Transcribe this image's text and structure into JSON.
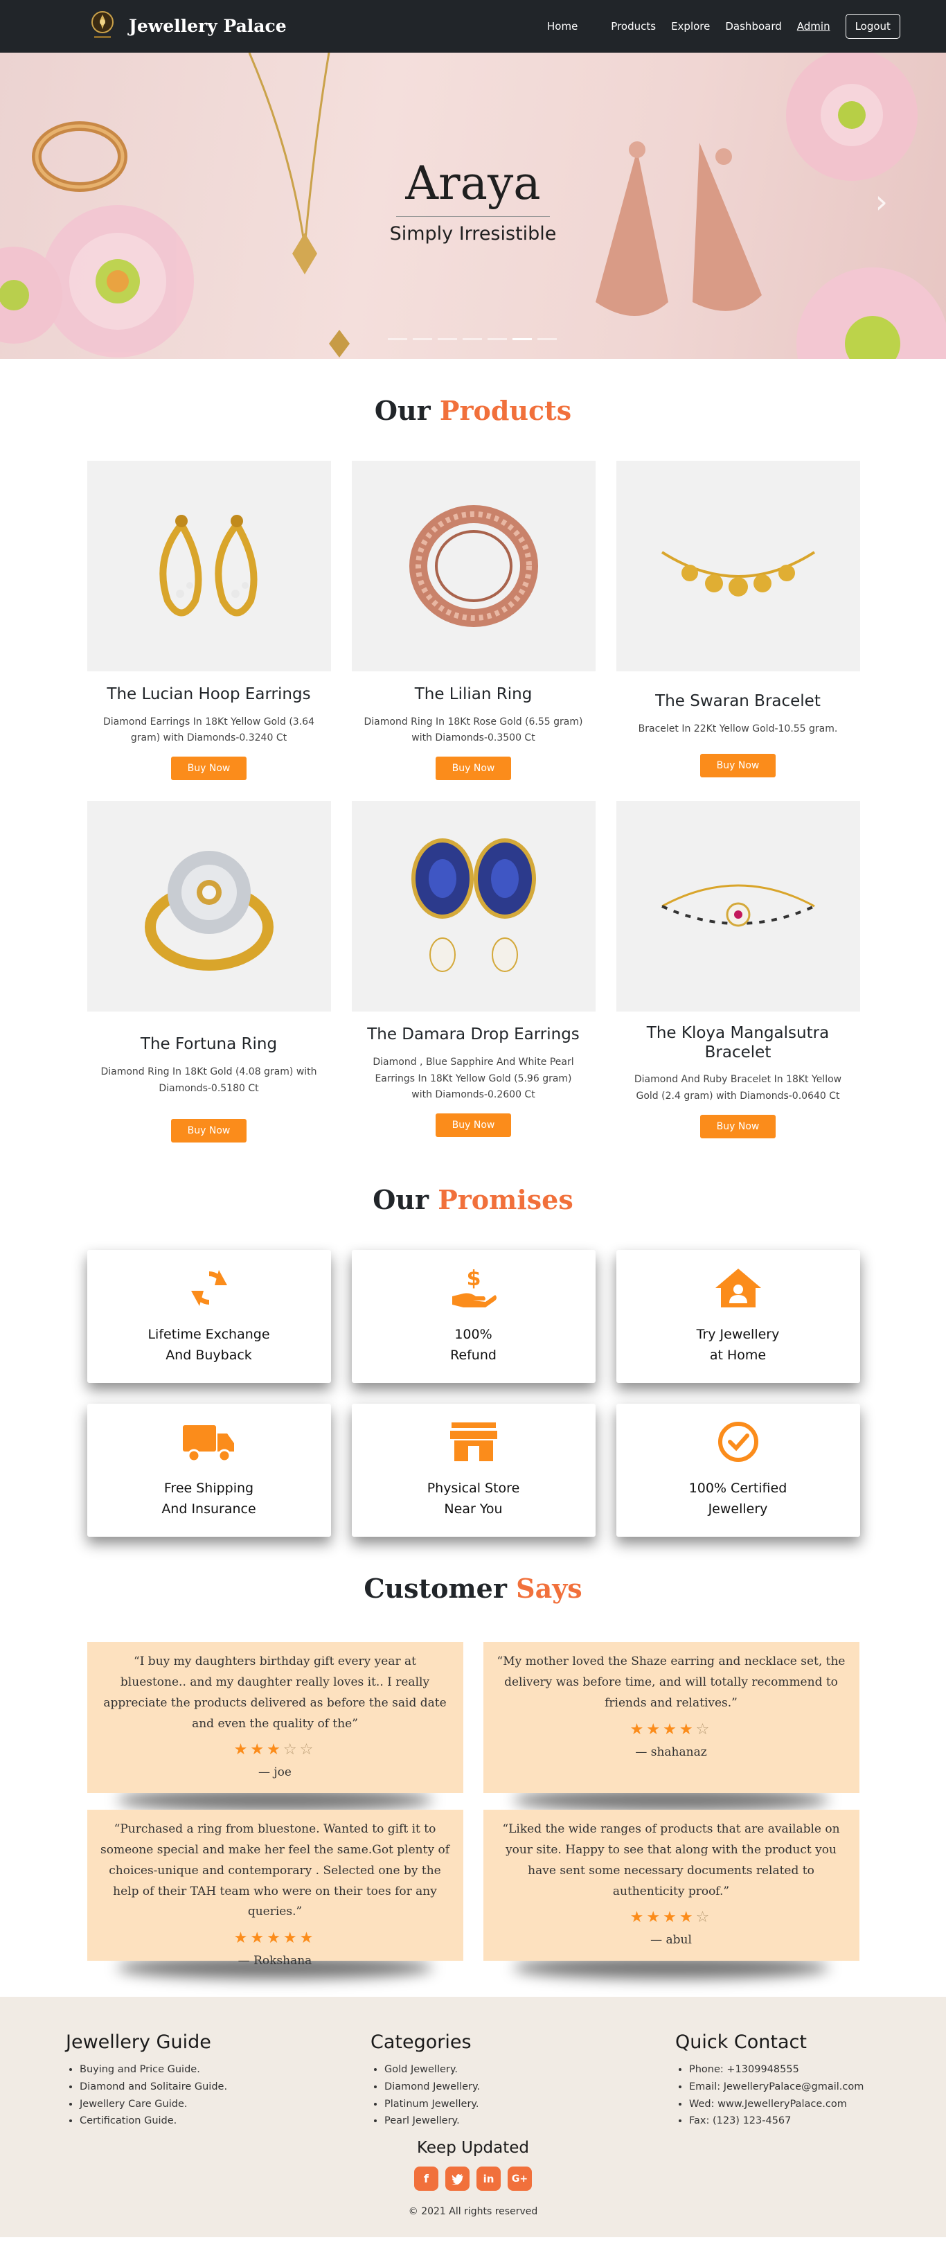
{
  "nav": {
    "brand": "Jewellery Palace",
    "links": [
      "Home",
      "Products",
      "Explore",
      "Dashboard",
      "Admin"
    ],
    "logout": "Logout"
  },
  "hero": {
    "title": "Araya",
    "subtitle": "Simply Irresistible",
    "slide_count": 7,
    "active_slide": 6
  },
  "products_section": {
    "title_plain": "Our",
    "title_accent": "Products",
    "items": [
      {
        "name": "The Lucian Hoop Earrings",
        "desc": "Diamond Earrings In 18Kt Yellow Gold (3.64 gram) with Diamonds-0.3240 Ct",
        "button": "Buy Now",
        "icon": "hoop-earrings-image"
      },
      {
        "name": "The Lilian Ring",
        "desc": "Diamond Ring In 18Kt Rose Gold (6.55 gram) with Diamonds-0.3500 Ct",
        "button": "Buy Now",
        "icon": "rose-gold-ring-image"
      },
      {
        "name": "The Swaran Bracelet",
        "desc": "Bracelet In 22Kt Yellow Gold-10.55 gram.",
        "button": "Buy Now",
        "icon": "gold-bracelet-image"
      },
      {
        "name": "The Fortuna Ring",
        "desc": "Diamond Ring In 18Kt Gold (4.08 gram) with Diamonds-0.5180 Ct",
        "button": "Buy Now",
        "icon": "diamond-ring-image"
      },
      {
        "name": "The Damara Drop Earrings",
        "desc": "Diamond , Blue Sapphire And White Pearl Earrings In 18Kt Yellow Gold (5.96 gram) with Diamonds-0.2600 Ct",
        "button": "Buy Now",
        "icon": "sapphire-earrings-image"
      },
      {
        "name": "The Kloya Mangalsutra Bracelet",
        "desc": "Diamond And Ruby Bracelet In 18Kt Yellow Gold (2.4 gram) with Diamonds-0.0640 Ct",
        "button": "Buy Now",
        "icon": "mangalsutra-bracelet-image"
      }
    ]
  },
  "promises_section": {
    "title_plain": "Our",
    "title_accent": "Promises",
    "items": [
      {
        "line1": "Lifetime Exchange",
        "line2": "And Buyback",
        "icon": "sync-icon"
      },
      {
        "line1": "100%",
        "line2": "Refund",
        "icon": "refund-hand-icon"
      },
      {
        "line1": "Try Jewellery",
        "line2": "at Home",
        "icon": "home-user-icon"
      },
      {
        "line1": "Free Shipping",
        "line2": "And Insurance",
        "icon": "truck-icon"
      },
      {
        "line1": "Physical Store",
        "line2": "Near You",
        "icon": "store-icon"
      },
      {
        "line1": "100% Certified",
        "line2": "Jewellery",
        "icon": "check-circle-icon"
      }
    ]
  },
  "reviews_section": {
    "title_plain": "Customer",
    "title_accent": "Says",
    "items": [
      {
        "text": "“I buy my daughters birthday gift every year at bluestone.. and my daughter really loves it.. I really appreciate the products delivered as before the said date and even the quality of the”",
        "rating": 3,
        "author": "— joe"
      },
      {
        "text": "“My mother loved the Shaze earring and necklace set, the delivery was before time, and will totally recommend to friends and relatives.”",
        "rating": 4,
        "author": "— shahanaz"
      },
      {
        "text": "“Purchased a ring from bluestone. Wanted to gift it to someone special and make her feel the same.Got plenty of choices-unique and contemporary . Selected one by the help of their TAH team who were on their toes for any queries.”",
        "rating": 5,
        "author": "— Rokshana"
      },
      {
        "text": "“Liked the wide ranges of products that are available on your site. Happy to see that along with the product you have sent some necessary documents related to authenticity proof.”",
        "rating": 4,
        "author": "— abul"
      }
    ]
  },
  "footer": {
    "guide_title": "Jewellery Guide",
    "guide_items": [
      "Buying and Price Guide.",
      "Diamond and Solitaire Guide.",
      "Jewellery Care Guide.",
      "Certification Guide."
    ],
    "categories_title": "Categories",
    "categories_items": [
      "Gold Jewellery.",
      "Diamond Jewellery.",
      "Platinum Jewellery.",
      "Pearl Jewellery."
    ],
    "contact_title": "Quick Contact",
    "contact_items": [
      "Phone: +1309948555",
      "Email: JewelleryPalace@gmail.com",
      "Wed: www.JewelleryPalace.com",
      "Fax: (123) 123-4567"
    ],
    "keep_updated": "Keep Updated",
    "social_icons": [
      "facebook-icon",
      "twitter-icon",
      "linkedin-icon",
      "google-plus-icon"
    ],
    "copyright": "© 2021 All rights reserved"
  },
  "colors": {
    "accent": "#f1703b",
    "button": "#fb8c1b",
    "nav_bg": "#212529",
    "review_bg": "#fde1bf",
    "footer_bg": "#f1ebe4"
  }
}
